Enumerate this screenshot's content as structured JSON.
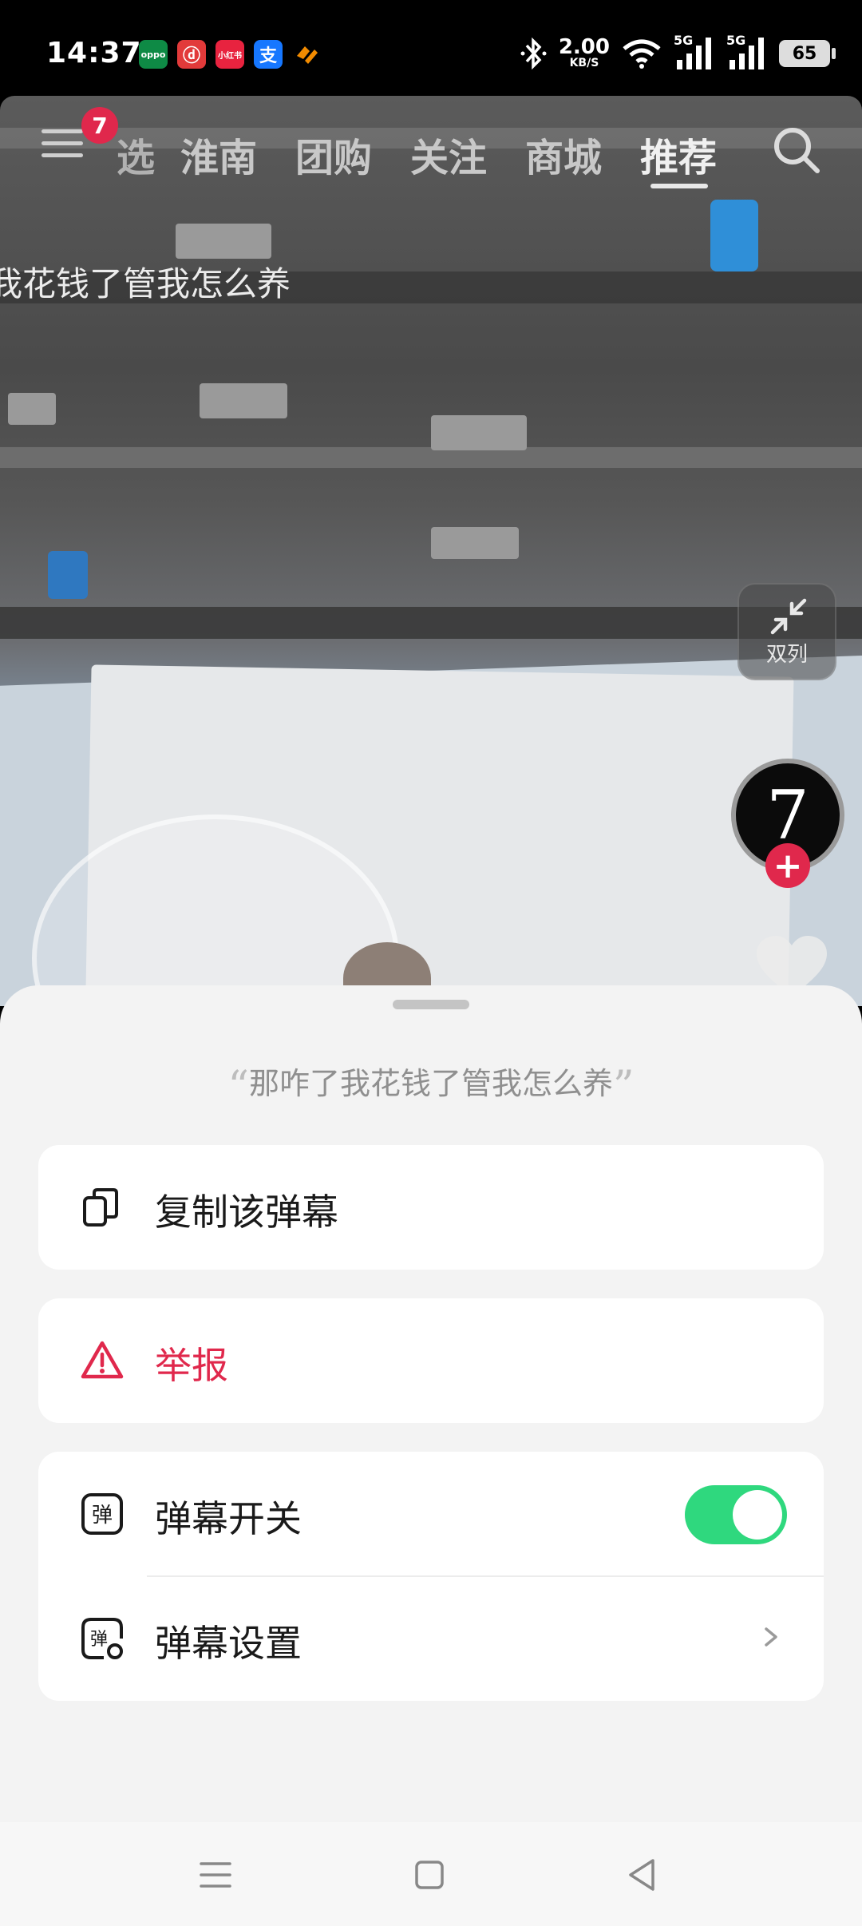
{
  "status_bar": {
    "time": "14:37",
    "net_speed_value": "2.00",
    "net_speed_unit": "KB/S",
    "signal1_label": "5G",
    "signal2_label": "5G",
    "battery": "65",
    "app_icons": [
      {
        "name": "oppo-store-icon",
        "text": "oppo",
        "color": "#0e8a45"
      },
      {
        "name": "netease-music-icon",
        "text": "ⓓ",
        "color": "#e23a3a"
      },
      {
        "name": "xiaohongshu-icon",
        "text": "小红书",
        "color": "#e8233f"
      },
      {
        "name": "alipay-icon",
        "text": "支",
        "color": "#1677ff"
      },
      {
        "name": "app-icon-orange",
        "text": "",
        "color": "#f28b00"
      }
    ]
  },
  "top_nav": {
    "menu_badge": "7",
    "tabs": [
      {
        "label": "选",
        "active": false
      },
      {
        "label": "淮南",
        "active": false
      },
      {
        "label": "团购",
        "active": false
      },
      {
        "label": "关注",
        "active": false
      },
      {
        "label": "商城",
        "active": false
      },
      {
        "label": "推荐",
        "active": true
      }
    ]
  },
  "video": {
    "danmaku_text": "我花钱了管我怎么养",
    "dual_column_label": "双列",
    "avatar_text": "7"
  },
  "sheet": {
    "quote_open": "“",
    "quote_text": "那咋了我花钱了管我怎么养",
    "quote_close": "”",
    "copy_label": "复制该弹幕",
    "report_label": "举报",
    "danmaku_toggle_label": "弹幕开关",
    "danmaku_toggle_on": true,
    "danmaku_settings_label": "弹幕设置",
    "toggle_color": "#2fd87e",
    "report_color": "#e0284c"
  }
}
